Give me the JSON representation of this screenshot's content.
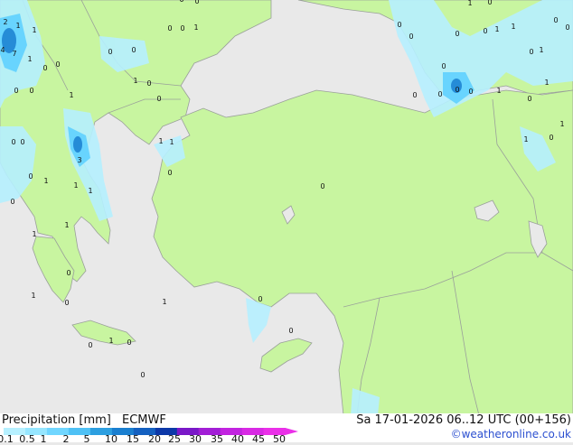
{
  "footer": {
    "title": "Precipitation [mm]",
    "model": "ECMWF",
    "datetime": "Sa 17-01-2026 06..12 UTC (00+156)",
    "credit": "©weatheronline.co.uk"
  },
  "legend": {
    "ticks": [
      "0.1",
      "0.5",
      "1",
      "2",
      "5",
      "10",
      "15",
      "20",
      "25",
      "30",
      "35",
      "40",
      "45",
      "50"
    ],
    "colors": [
      "#b6f0ff",
      "#96e6ff",
      "#70d6ff",
      "#4fc1f5",
      "#2d9fe0",
      "#1a7fd0",
      "#1460c0",
      "#0c38a8",
      "#7a18c8",
      "#a21ed6",
      "#c224e0",
      "#d82ae4",
      "#ea30e8"
    ]
  },
  "colors": {
    "sea": "#e9e9e9",
    "land_precip_free": "#c8f5a0",
    "borders": "#9aa09a",
    "light_precip": "#b6f0ff",
    "moderate_precip": "#5fd0ff",
    "heavy_precip": "#1a7fd0"
  },
  "map_labels": [
    "2",
    "1",
    "1",
    "4",
    "7",
    "1",
    "0",
    "0",
    "1",
    "0",
    "0",
    "1",
    "0",
    "0",
    "0",
    "0",
    "0",
    "0",
    "3",
    "1",
    "0",
    "0",
    "0",
    "1",
    "1",
    "0",
    "1",
    "1",
    "0",
    "1",
    "0",
    "0",
    "1",
    "0",
    "0",
    "1",
    "1",
    "1",
    "0",
    "0",
    "0",
    "0",
    "1",
    "0",
    "0",
    "0",
    "0",
    "0",
    "1",
    "0",
    "1",
    "1",
    "0",
    "1",
    "0",
    "0",
    "1",
    "1",
    "0",
    "1",
    "0",
    "0",
    "0",
    "0",
    "1",
    "0",
    "0",
    "0"
  ]
}
